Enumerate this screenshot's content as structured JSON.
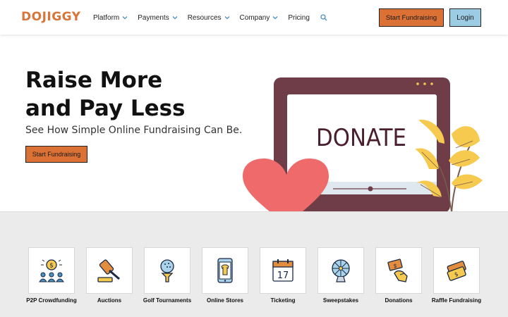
{
  "header": {
    "logo": "DOJIGGY",
    "nav": [
      {
        "label": "Platform"
      },
      {
        "label": "Payments"
      },
      {
        "label": "Resources"
      },
      {
        "label": "Company"
      },
      {
        "label": "Pricing"
      }
    ],
    "start_label": "Start Fundraising",
    "login_label": "Login"
  },
  "hero": {
    "title_line1": "Raise More",
    "title_line2": "and Pay Less",
    "subtitle": "See How Simple Online Fundraising Can Be.",
    "cta_label": "Start Fundraising",
    "screen_text": "DONATE"
  },
  "categories": [
    {
      "label": "P2P Crowdfunding",
      "icon": "crowdfunding-icon"
    },
    {
      "label": "Auctions",
      "icon": "gavel-icon"
    },
    {
      "label": "Golf Tournaments",
      "icon": "golf-ball-icon"
    },
    {
      "label": "Online Stores",
      "icon": "online-store-icon"
    },
    {
      "label": "Ticketing",
      "icon": "calendar-icon"
    },
    {
      "label": "Sweepstakes",
      "icon": "prize-wheel-icon"
    },
    {
      "label": "Donations",
      "icon": "donation-hand-icon"
    },
    {
      "label": "Raffle Fundraising",
      "icon": "raffle-ticket-icon"
    }
  ],
  "colors": {
    "brand_orange": "#db7135",
    "login_blue": "#9ccbe4",
    "monitor": "#6e3d47",
    "heart": "#ef6b6b",
    "leaf": "#f6c94f"
  }
}
